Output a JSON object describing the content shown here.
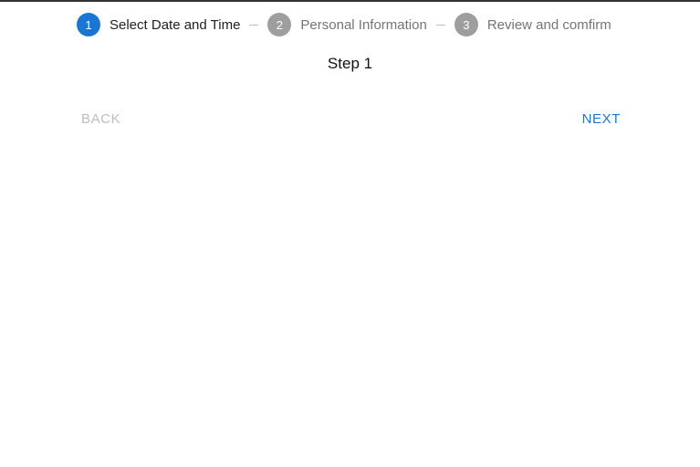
{
  "stepper": {
    "steps": [
      {
        "number": "1",
        "label": "Select Date and Time",
        "state": "active"
      },
      {
        "number": "2",
        "label": "Personal Information",
        "state": "inactive"
      },
      {
        "number": "3",
        "label": "Review and comfirm",
        "state": "inactive"
      }
    ]
  },
  "content": {
    "step_title": "Step 1"
  },
  "navigation": {
    "back_label": "BACK",
    "back_disabled": true,
    "next_label": "NEXT"
  },
  "colors": {
    "active_step": "#1976d2",
    "inactive_step": "#9e9e9e",
    "active_label": "#212121",
    "inactive_label": "#757575",
    "next_button": "#1976d2",
    "back_button_disabled": "#bdbdbd"
  }
}
